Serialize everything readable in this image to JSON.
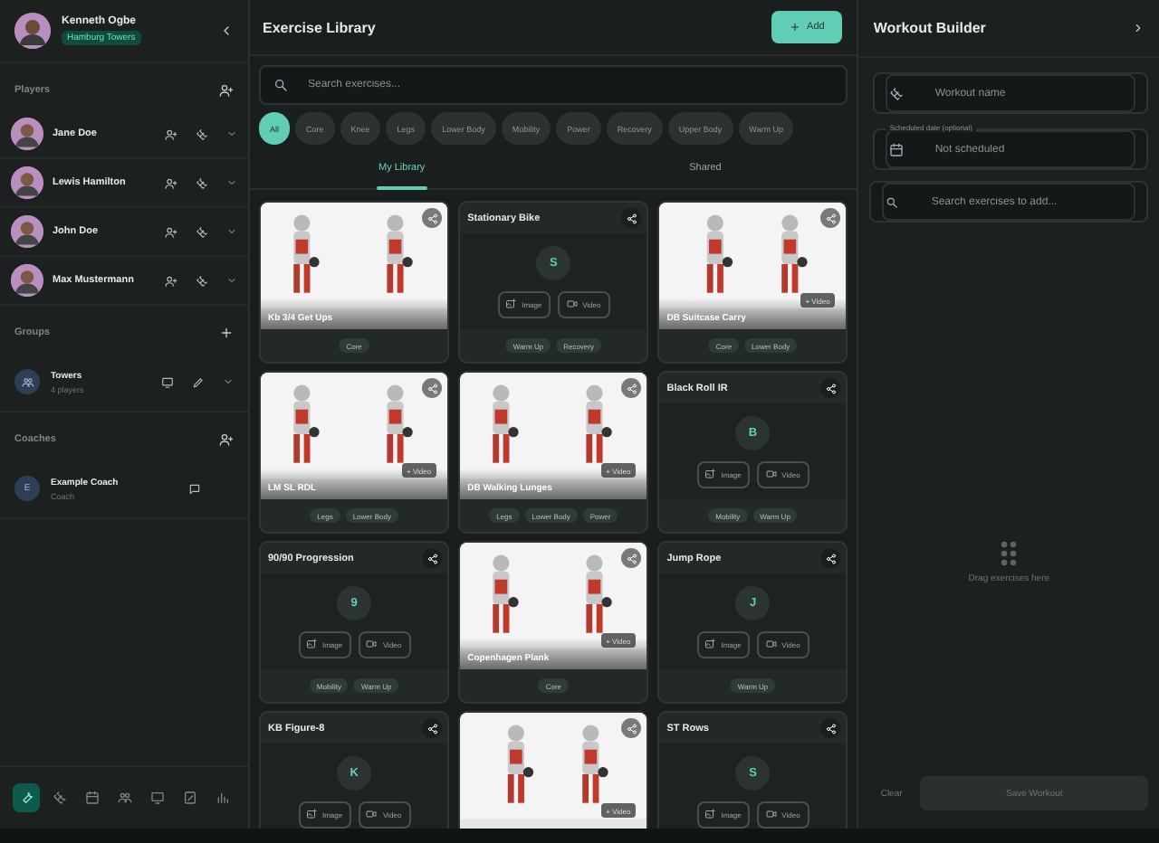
{
  "user": {
    "name": "Kenneth Ogbe",
    "team": "Hamburg Towers"
  },
  "players": {
    "title": "Players",
    "items": [
      {
        "name": "Jane Doe"
      },
      {
        "name": "Lewis Hamilton"
      },
      {
        "name": "John Doe"
      },
      {
        "name": "Max Mustermann"
      }
    ]
  },
  "groups": {
    "title": "Groups",
    "items": [
      {
        "name": "Towers",
        "subtitle": "4 players"
      }
    ]
  },
  "coaches": {
    "title": "Coaches",
    "items": [
      {
        "initial": "E",
        "name": "Example Coach",
        "subtitle": "Coach"
      }
    ]
  },
  "nav": [
    {
      "selected": true
    },
    {
      "selected": false
    },
    {
      "selected": false
    },
    {
      "selected": false
    },
    {
      "selected": false
    },
    {
      "selected": false
    },
    {
      "selected": false
    }
  ],
  "library": {
    "title": "Exercise Library",
    "add_label": "Add",
    "search_placeholder": "Search exercises...",
    "filters": [
      {
        "label": "All",
        "selected": true
      },
      {
        "label": "Core",
        "selected": false
      },
      {
        "label": "Knee",
        "selected": false
      },
      {
        "label": "Legs",
        "selected": false
      },
      {
        "label": "Lower Body",
        "selected": false
      },
      {
        "label": "Mobility",
        "selected": false
      },
      {
        "label": "Power",
        "selected": false
      },
      {
        "label": "Recovery",
        "selected": false
      },
      {
        "label": "Upper Body",
        "selected": false
      },
      {
        "label": "Warm Up",
        "selected": false
      }
    ],
    "tabs": [
      {
        "label": "My Library",
        "selected": true
      },
      {
        "label": "Shared",
        "selected": false
      }
    ],
    "exercises": [
      {
        "kind": "picture",
        "title": "Kb 3/4 Get Ups",
        "tags": [
          "Core"
        ]
      },
      {
        "kind": "placeholder",
        "title": "Stationary Bike",
        "initial": "S",
        "image_label": "Image",
        "video_label": "Video",
        "tags": [
          "Warm Up",
          "Recovery"
        ]
      },
      {
        "kind": "picture",
        "title": "DB Suitcase Carry",
        "video_badge": "+ Video",
        "tags": [
          "Core",
          "Lower Body"
        ]
      },
      {
        "kind": "picture",
        "title": "LM SL RDL",
        "video_badge": "+ Video",
        "tags": [
          "Legs",
          "Lower Body"
        ]
      },
      {
        "kind": "picture",
        "title": "DB Walking Lunges",
        "video_badge": "+ Video",
        "tags": [
          "Legs",
          "Lower Body",
          "Power"
        ]
      },
      {
        "kind": "placeholder",
        "title": "Black Roll IR",
        "initial": "B",
        "image_label": "Image",
        "video_label": "Video",
        "tags": [
          "Mobility",
          "Warm Up"
        ]
      },
      {
        "kind": "placeholder",
        "title": "90/90 Progression",
        "initial": "9",
        "image_label": "Image",
        "video_label": "Video",
        "tags": [
          "Mobility",
          "Warm Up"
        ]
      },
      {
        "kind": "picture",
        "title": "Copenhagen Plank",
        "video_badge": "+ Video",
        "tags": [
          "Core"
        ]
      },
      {
        "kind": "placeholder",
        "title": "Jump Rope",
        "initial": "J",
        "image_label": "Image",
        "video_label": "Video",
        "tags": [
          "Warm Up"
        ]
      },
      {
        "kind": "placeholder",
        "title": "KB Figure-8",
        "initial": "K",
        "image_label": "Image",
        "video_label": "Video"
      },
      {
        "kind": "picture",
        "video_badge": "+ Video"
      },
      {
        "kind": "placeholder",
        "title": "ST Rows",
        "initial": "S",
        "image_label": "Image",
        "video_label": "Video"
      }
    ]
  },
  "builder": {
    "title": "Workout Builder",
    "name_placeholder": "Workout name",
    "date_label": "Scheduled date (optional)",
    "date_placeholder": "Not scheduled",
    "search_placeholder": "Search exercises to add...",
    "empty_text": "Drag exercises here",
    "clear_label": "Clear",
    "save_label": "Save Workout",
    "save_disabled": true
  }
}
